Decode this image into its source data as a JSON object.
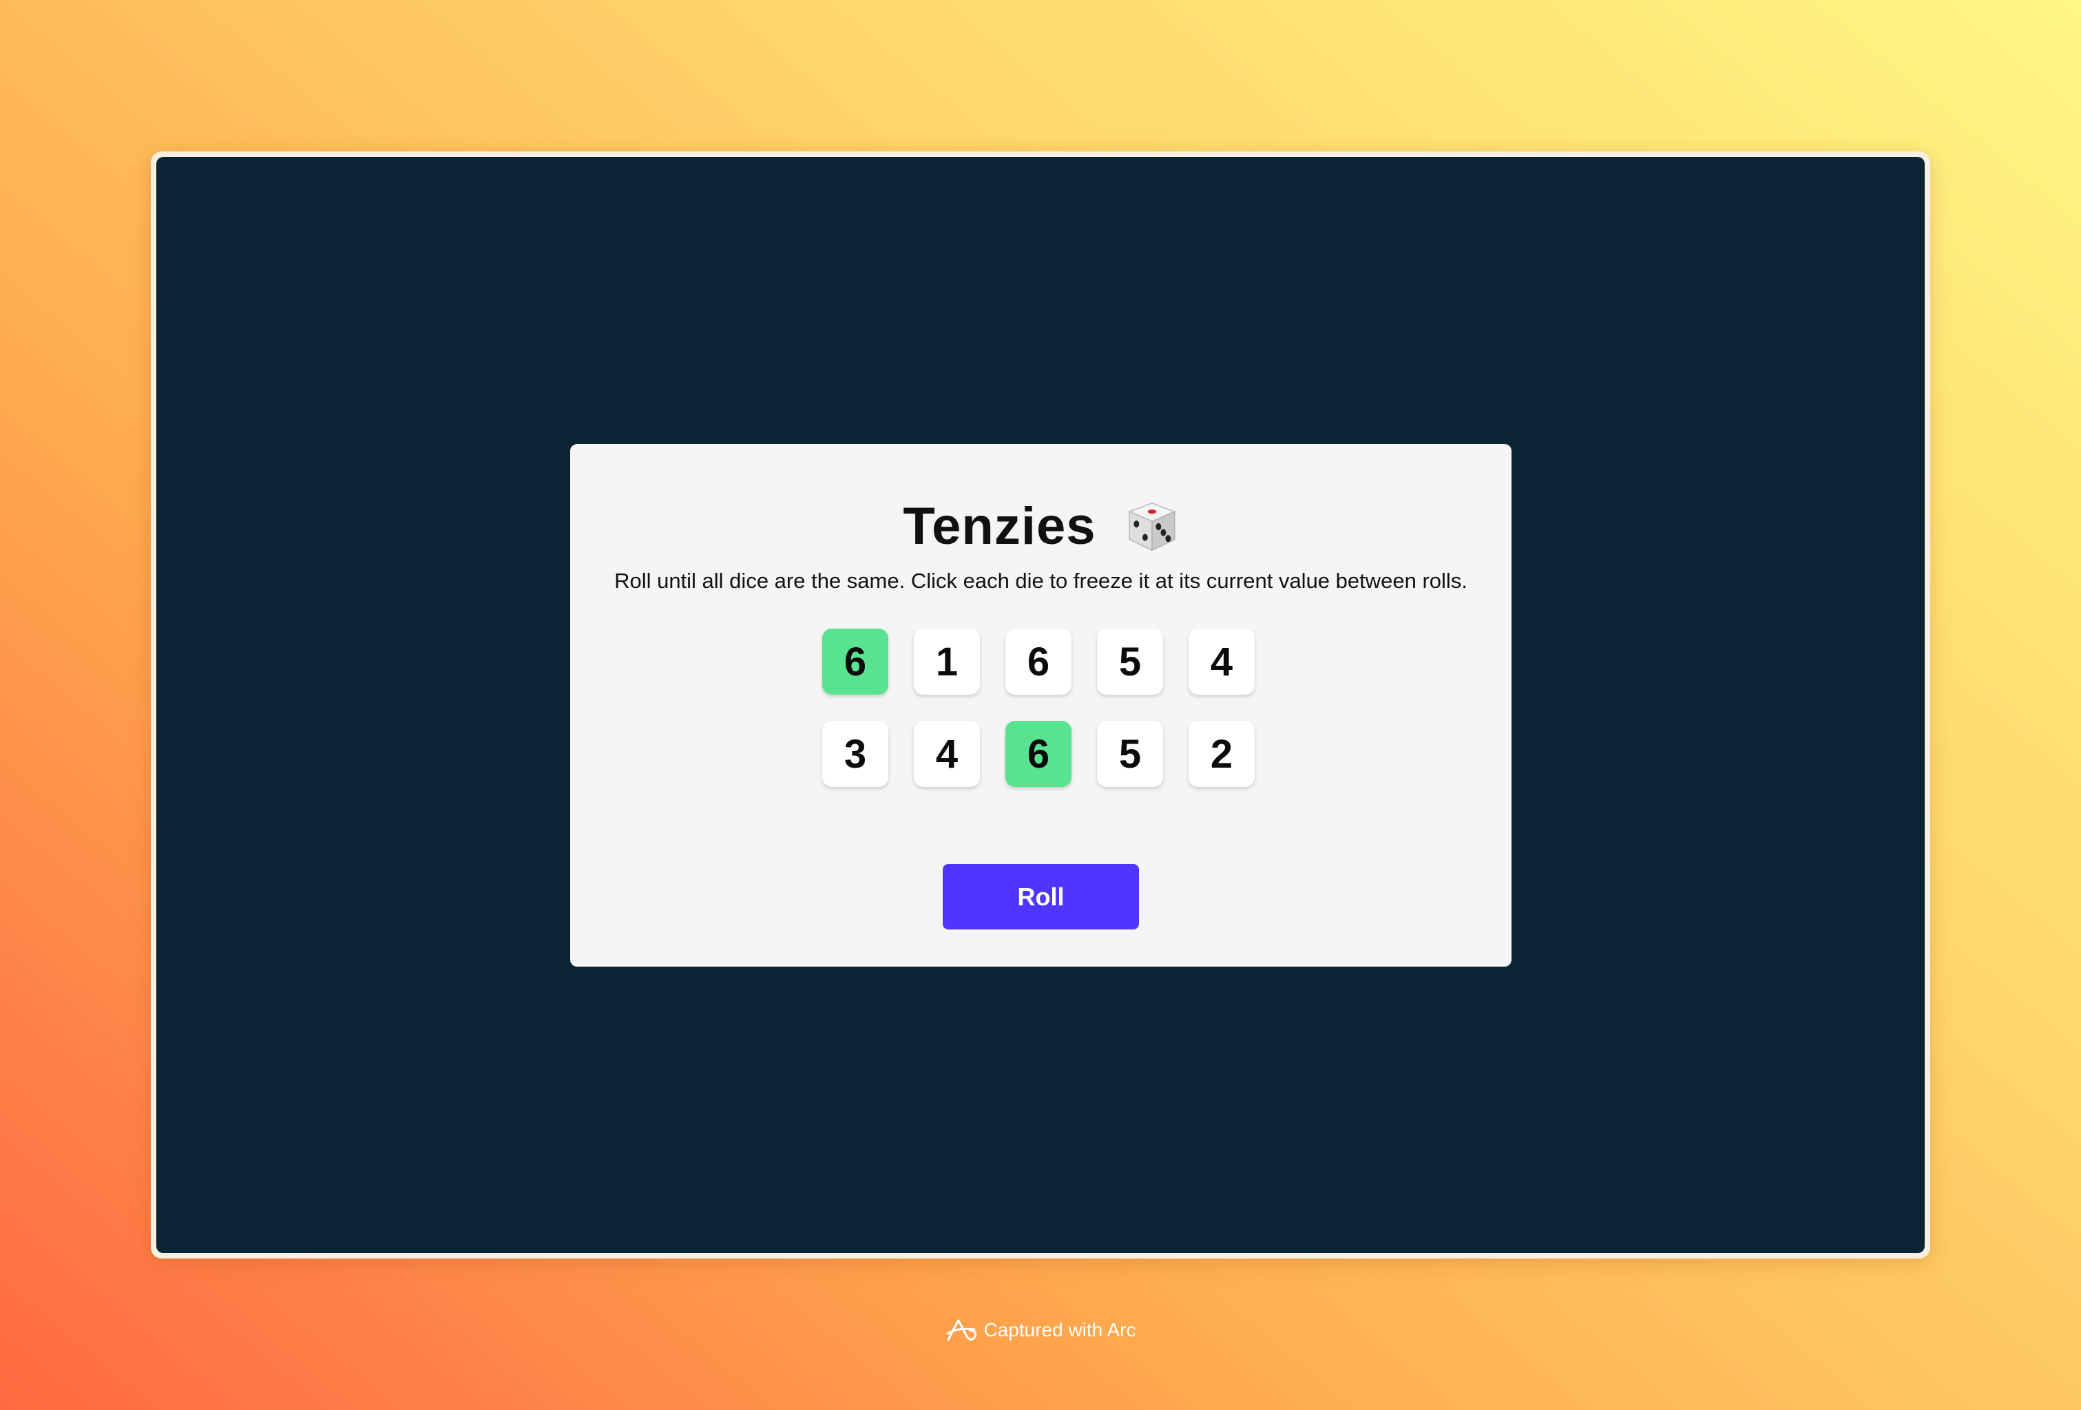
{
  "game": {
    "title": "Tenzies",
    "title_icon": "game-die-icon",
    "instructions": "Roll until all dice are the same. Click each die to freeze it at its current value between rolls.",
    "dice": [
      {
        "value": "6",
        "held": true
      },
      {
        "value": "1",
        "held": false
      },
      {
        "value": "6",
        "held": false
      },
      {
        "value": "5",
        "held": false
      },
      {
        "value": "4",
        "held": false
      },
      {
        "value": "3",
        "held": false
      },
      {
        "value": "4",
        "held": false
      },
      {
        "value": "6",
        "held": true
      },
      {
        "value": "5",
        "held": false
      },
      {
        "value": "2",
        "held": false
      }
    ],
    "roll_label": "Roll"
  },
  "footer": {
    "label": "Captured with Arc",
    "icon": "arc-logo-icon"
  },
  "colors": {
    "page_background": "#0b2434",
    "card_background": "#f5f5f5",
    "die_background": "#ffffff",
    "held_die_background": "#59e391",
    "roll_button": "#5035ff"
  }
}
